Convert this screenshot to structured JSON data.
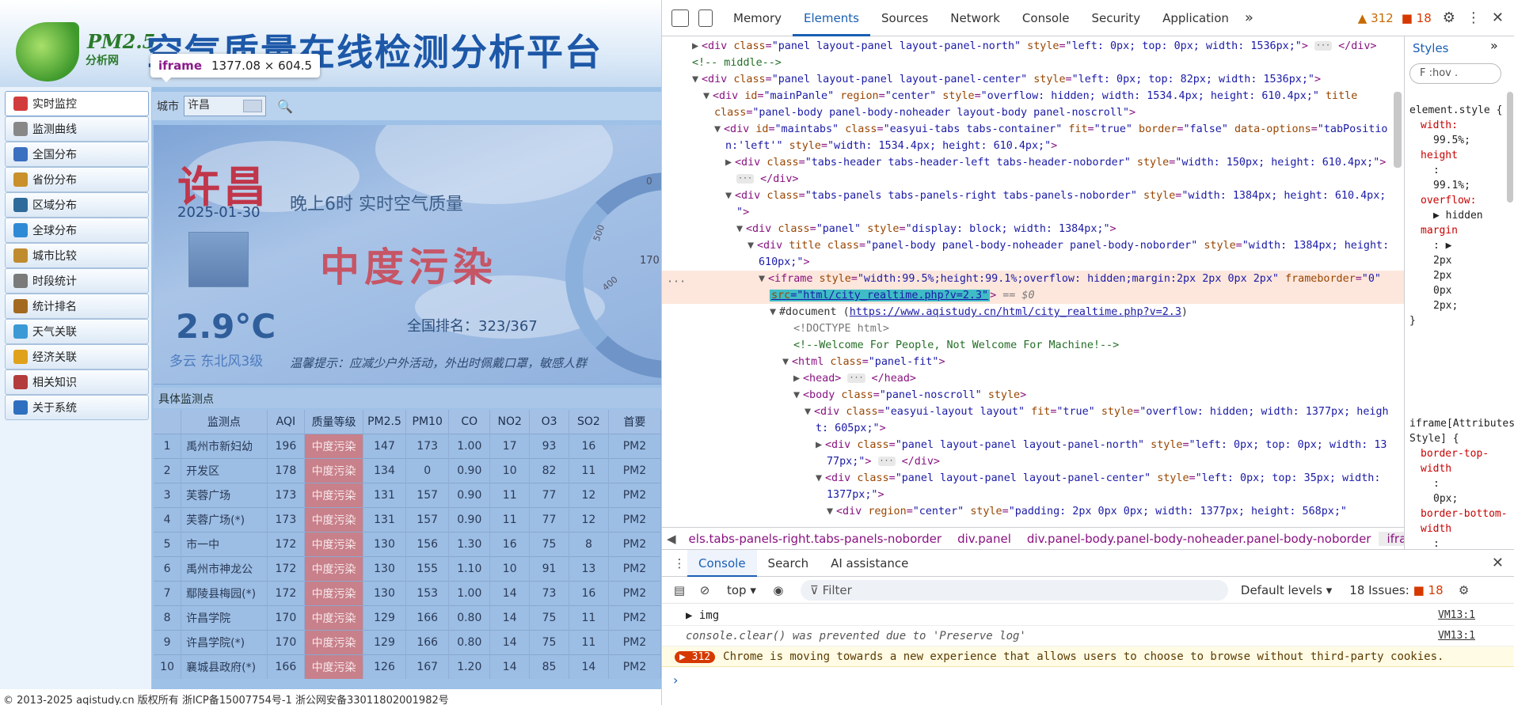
{
  "site": {
    "logo_text": "PM2.5",
    "logo_sub": "分析网",
    "title": "空气质量在线检测分析平台",
    "footer": "© 2013-2025 aqistudy.cn 版权所有 浙ICP备15007754号-1 浙公网安备33011802001982号"
  },
  "tooltip": {
    "tag": "iframe",
    "size": "1377.08 × 604.5"
  },
  "sidebar": {
    "items": [
      {
        "label": "实时监控",
        "icon": "monitor-icon",
        "color": "#d23b3b"
      },
      {
        "label": "监测曲线",
        "icon": "curve-icon",
        "color": "#888888"
      },
      {
        "label": "全国分布",
        "icon": "map-icon",
        "color": "#3b6fbf"
      },
      {
        "label": "省份分布",
        "icon": "province-icon",
        "color": "#c9902c"
      },
      {
        "label": "区域分布",
        "icon": "region-icon",
        "color": "#2f6b9a"
      },
      {
        "label": "全球分布",
        "icon": "globe-icon",
        "color": "#2f8ad6"
      },
      {
        "label": "城市比较",
        "icon": "city-compare-icon",
        "color": "#c08b2f"
      },
      {
        "label": "时段统计",
        "icon": "clock-icon",
        "color": "#7a7a7a"
      },
      {
        "label": "统计排名",
        "icon": "ranking-icon",
        "color": "#a36a1f"
      },
      {
        "label": "天气关联",
        "icon": "weather-icon",
        "color": "#3b9ad6"
      },
      {
        "label": "经济关联",
        "icon": "economy-icon",
        "color": "#e0a21b"
      },
      {
        "label": "相关知识",
        "icon": "book-icon",
        "color": "#b33b3b"
      },
      {
        "label": "关于系统",
        "icon": "info-icon",
        "color": "#2f6fbf"
      }
    ]
  },
  "citybar": {
    "label": "城市",
    "value": "许昌"
  },
  "banner": {
    "city": "许昌",
    "date": "2025-01-30",
    "subhead": "晚上6时 实时空气质量",
    "level": "中度污染",
    "rank": "全国排名：323/367",
    "temp": "2.9°C",
    "weather": "多云 东北风3级",
    "tip": "温馨提示：应减少户外活动，外出时佩戴口罩，敏感人群",
    "gauge_0": "0",
    "gauge_500": "500",
    "gauge_170": "170",
    "gauge_400": "400"
  },
  "monitor": {
    "title": "具体监测点",
    "columns": [
      "",
      "监测点",
      "AQI",
      "质量等级",
      "PM2.5",
      "PM10",
      "CO",
      "NO2",
      "O3",
      "SO2",
      "首要"
    ],
    "rows": [
      [
        "1",
        "禹州市新妇幼",
        "196",
        "中度污染",
        "147",
        "173",
        "1.00",
        "17",
        "93",
        "16",
        "PM2"
      ],
      [
        "2",
        "开发区",
        "178",
        "中度污染",
        "134",
        "0",
        "0.90",
        "10",
        "82",
        "11",
        "PM2"
      ],
      [
        "3",
        "芙蓉广场",
        "173",
        "中度污染",
        "131",
        "157",
        "0.90",
        "11",
        "77",
        "12",
        "PM2"
      ],
      [
        "4",
        "芙蓉广场(*)",
        "173",
        "中度污染",
        "131",
        "157",
        "0.90",
        "11",
        "77",
        "12",
        "PM2"
      ],
      [
        "5",
        "市一中",
        "172",
        "中度污染",
        "130",
        "156",
        "1.30",
        "16",
        "75",
        "8",
        "PM2"
      ],
      [
        "6",
        "禹州市神龙公",
        "172",
        "中度污染",
        "130",
        "155",
        "1.10",
        "10",
        "91",
        "13",
        "PM2"
      ],
      [
        "7",
        "鄢陵县梅园(*)",
        "172",
        "中度污染",
        "130",
        "153",
        "1.00",
        "14",
        "73",
        "16",
        "PM2"
      ],
      [
        "8",
        "许昌学院",
        "170",
        "中度污染",
        "129",
        "166",
        "0.80",
        "14",
        "75",
        "11",
        "PM2"
      ],
      [
        "9",
        "许昌学院(*)",
        "170",
        "中度污染",
        "129",
        "166",
        "0.80",
        "14",
        "75",
        "11",
        "PM2"
      ],
      [
        "10",
        "襄城县政府(*)",
        "166",
        "中度污染",
        "126",
        "167",
        "1.20",
        "14",
        "85",
        "14",
        "PM2"
      ]
    ]
  },
  "devtools": {
    "tabs": [
      "Memory",
      "Elements",
      "Sources",
      "Network",
      "Console",
      "Security",
      "Application"
    ],
    "active_tab": "Elements",
    "warnings": "312",
    "errors": "18",
    "breadcrumbs": [
      "els.tabs-panels-right.tabs-panels-noborder",
      "div.panel",
      "div.panel-body.panel-body-noheader.panel-body-noborder",
      "iframe"
    ],
    "styles": {
      "tab": "Styles",
      "filter": "F  :hov  .",
      "rule1_sel": "element.style {",
      "rule1": [
        "width:",
        "99.5%;",
        "height",
        ":",
        "99.1%;",
        "overflow:",
        "▶ hidden",
        "margin",
        ": ▶",
        "2px",
        "2px",
        "0px",
        "2px;",
        "}"
      ],
      "rule2_sel": "iframe[Attributes Style] {",
      "rule2": [
        "border-top-width",
        ":",
        "0px;",
        "border-bottom-width",
        ":"
      ]
    },
    "drawer_tabs": [
      "Console",
      "Search",
      "AI assistance"
    ],
    "context": "top",
    "filter_placeholder": "Filter",
    "levels": "Default levels",
    "issues_label": "18 Issues:",
    "issues_count": "18",
    "messages": [
      {
        "text": "▶ img",
        "source": "VM13:1"
      },
      {
        "text": "console.clear() was prevented due to 'Preserve log'",
        "source": "VM13:1"
      },
      {
        "badge": "312",
        "text": "Chrome is moving towards a new experience that allows users to choose to browse without third-party cookies."
      }
    ],
    "prompt": "›"
  }
}
